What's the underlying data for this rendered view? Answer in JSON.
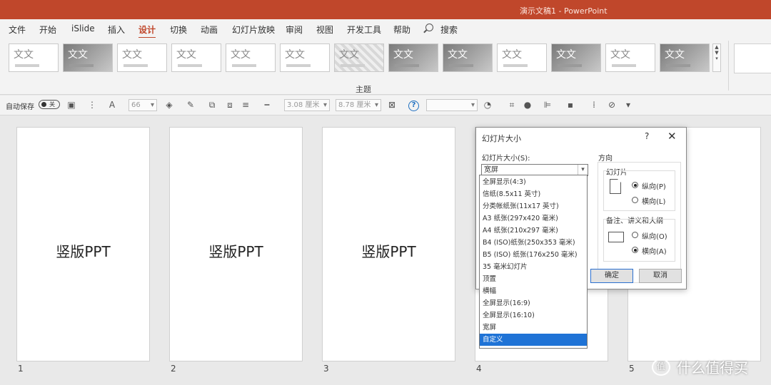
{
  "window": {
    "title": "演示文稿1  -  PowerPoint"
  },
  "tabs": [
    "文件",
    "开始",
    "iSlide",
    "插入",
    "设计",
    "切换",
    "动画",
    "幻灯片放映",
    "审阅",
    "视图",
    "开发工具",
    "帮助"
  ],
  "active_tab": "设计",
  "search": {
    "label": "搜索"
  },
  "ribbon": {
    "theme_sample_text": "文文",
    "group_label": "主题"
  },
  "qat": {
    "autosave_label": "自动保存",
    "autosave_state": "关",
    "font_size": "66",
    "width_value": "3.08 厘米",
    "height_value": "8.78 厘米"
  },
  "slides": [
    {
      "number": "1",
      "text": "竖版PPT"
    },
    {
      "number": "2",
      "text": "竖版PPT"
    },
    {
      "number": "3",
      "text": "竖版PPT"
    },
    {
      "number": "4",
      "text": ""
    },
    {
      "number": "5",
      "text": ""
    }
  ],
  "dialog": {
    "title": "幻灯片大小",
    "help": "?",
    "close": "✕",
    "size_label": "幻灯片大小(S):",
    "size_value": "宽屏",
    "orientation_title": "方向",
    "slide_group": "幻灯片",
    "slide_portrait": "纵向(P)",
    "slide_landscape": "横向(L)",
    "notes_group": "备注、讲义和大纲",
    "notes_portrait": "纵向(O)",
    "notes_landscape": "横向(A)",
    "ok": "确定",
    "cancel": "取消"
  },
  "dropdown_options": [
    "全屏显示(4:3)",
    "信纸(8.5x11 英寸)",
    "分类帐纸张(11x17 英寸)",
    "A3 纸张(297x420 毫米)",
    "A4 纸张(210x297 毫米)",
    "B4 (ISO)纸张(250x353 毫米)",
    "B5 (ISO) 纸张(176x250 毫米)",
    "35 毫米幻灯片",
    "顶置",
    "横幅",
    "全屏显示(16:9)",
    "全屏显示(16:10)",
    "宽屏",
    "自定义"
  ],
  "selected_option": "自定义",
  "watermark": {
    "text": "什么值得买",
    "logo": "值"
  },
  "colors": {
    "accent": "#c0472b",
    "selection": "#1f73d6"
  }
}
